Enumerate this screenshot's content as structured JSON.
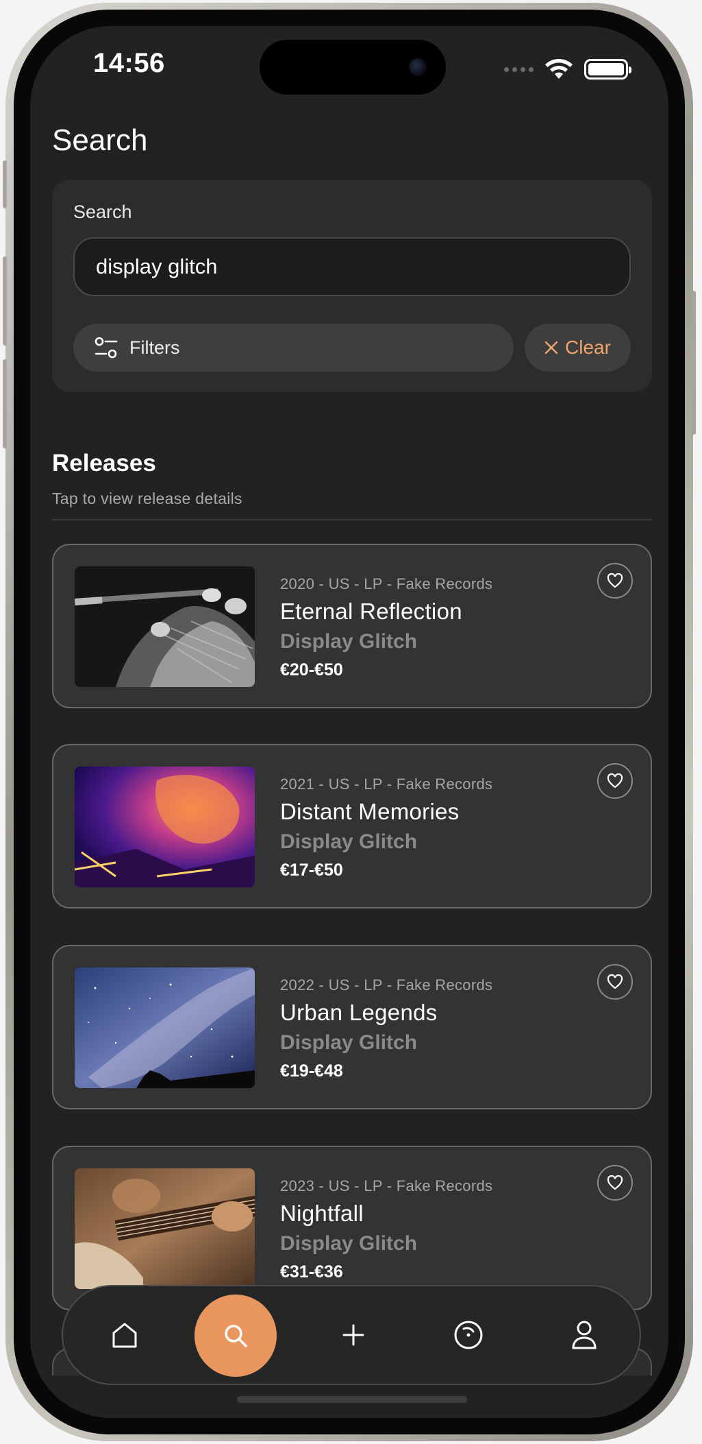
{
  "status_bar": {
    "time": "14:56"
  },
  "page": {
    "title": "Search"
  },
  "search": {
    "label": "Search",
    "value": "display glitch",
    "filters_label": "Filters",
    "clear_label": "Clear"
  },
  "releases": {
    "title": "Releases",
    "subtitle": "Tap to view release details",
    "items": [
      {
        "meta": "2020 - US - LP - Fake Records",
        "title": "Eternal Reflection",
        "artist": "Display Glitch",
        "price": "€20-€50"
      },
      {
        "meta": "2021 - US - LP - Fake Records",
        "title": "Distant Memories",
        "artist": "Display Glitch",
        "price": "€17-€50"
      },
      {
        "meta": "2022 - US - LP - Fake Records",
        "title": "Urban Legends",
        "artist": "Display Glitch",
        "price": "€19-€48"
      },
      {
        "meta": "2023 - US - LP - Fake Records",
        "title": "Nightfall",
        "artist": "Display Glitch",
        "price": "€31-€36"
      }
    ]
  },
  "tab_bar": {
    "tabs": [
      "home-icon",
      "search-icon",
      "plus-icon",
      "vinyl-icon",
      "profile-icon"
    ],
    "active": "search-icon"
  },
  "colors": {
    "accent": "#e9965f",
    "clear_text": "#f0a46c",
    "background": "#222222",
    "card": "#333333"
  }
}
